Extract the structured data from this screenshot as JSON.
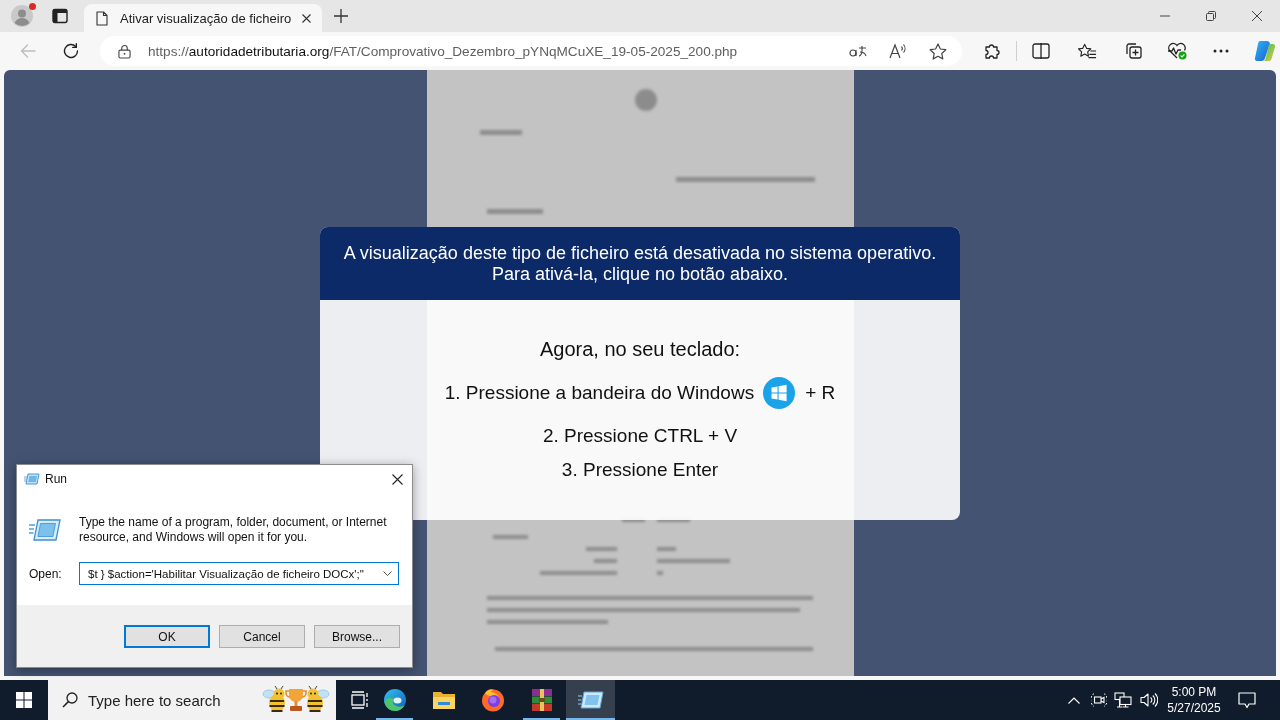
{
  "browser": {
    "profile": {
      "notification_dot": true
    },
    "tabs": [
      {
        "title": "Ativar visualização de ficheiro",
        "selected": true
      }
    ],
    "back_disabled": true,
    "address": {
      "scheme": "https://",
      "host": "autoridadetributaria.org",
      "path": "/FAT/Comprovativo_Dezembro_pYNqMCuXE_19-05-2025_200.php"
    }
  },
  "page": {
    "modal": {
      "header_lines": [
        "A visualização deste tipo de ficheiro está desativada no sistema operativo.",
        "Para ativá-la, clique no botão abaixo."
      ],
      "intro": "Agora, no seu teclado:",
      "steps": [
        {
          "text": "1. Pressione a bandeira do Windows",
          "windows_icon": true,
          "suffix": "+ R"
        },
        {
          "text": "2. Pressione CTRL + V",
          "windows_icon": false
        },
        {
          "text": "3. Pressione Enter",
          "windows_icon": false
        }
      ]
    }
  },
  "run_dialog": {
    "title": "Run",
    "description": "Type the name of a program, folder, document, or Internet resource, and Windows will open it for you.",
    "open_label": "Open:",
    "open_value": "$t } $action='Habilitar Visualização de ficheiro DOCx';\"",
    "buttons": [
      {
        "label": "OK",
        "default": true
      },
      {
        "label": "Cancel",
        "default": false
      },
      {
        "label": "Browse...",
        "default": false
      }
    ]
  },
  "taskbar": {
    "search_placeholder": "Type here to search",
    "apps": [
      {
        "kind": "edge",
        "running": true,
        "active": false
      },
      {
        "kind": "explorer",
        "running": false,
        "active": false
      },
      {
        "kind": "firefox",
        "running": false,
        "active": false
      },
      {
        "kind": "winrar",
        "running": true,
        "active": false
      },
      {
        "kind": "run",
        "running": true,
        "active": true
      }
    ],
    "clock": {
      "time": "5:00 PM",
      "date": "5/27/2025"
    }
  }
}
